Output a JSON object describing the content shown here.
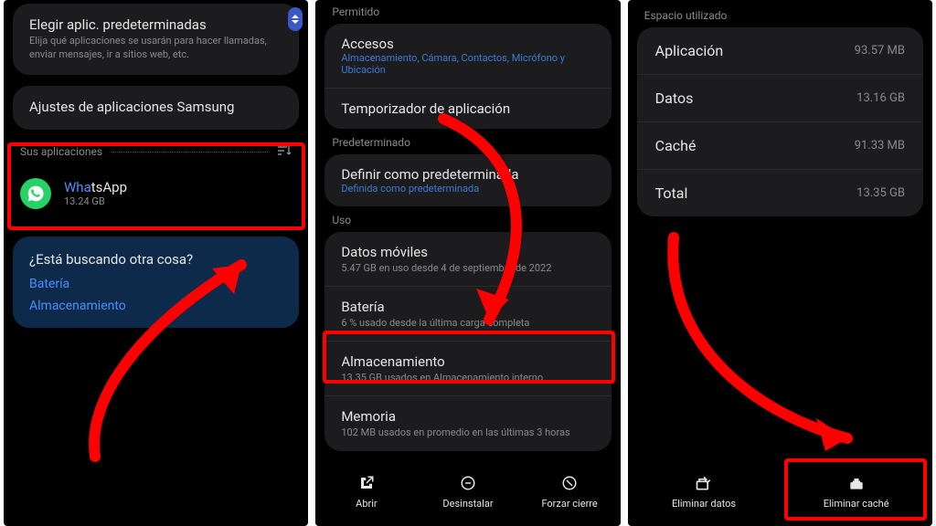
{
  "panel1": {
    "defaultApps": {
      "title": "Elegir aplic. predeterminadas",
      "sub": "Elija qué aplicaciones se usarán para hacer llamadas, enviar mensajes, ir a sitios web, etc."
    },
    "samsungSettings": "Ajustes de aplicaciones Samsung",
    "yourApps": "Sus aplicaciones",
    "app": {
      "namePrefix": "Wha",
      "nameRest": "tsApp",
      "size": "13.24 GB"
    },
    "suggest": {
      "title": "¿Está buscando otra cosa?",
      "battery": "Batería",
      "storage": "Almacenamiento"
    }
  },
  "panel2": {
    "permitted": "Permitido",
    "access": {
      "title": "Accesos",
      "sub": "Almacenamiento, Cámara, Contactos, Micrófono y Ubicación"
    },
    "timer": "Temporizador de aplicación",
    "defaultHeader": "Predeterminado",
    "setDefault": {
      "title": "Definir como predeterminada",
      "sub": "Definida como predeterminada"
    },
    "usageHeader": "Uso",
    "mobileData": {
      "title": "Datos móviles",
      "sub": "5.47 GB en uso desde 4 de septiembre de 2022"
    },
    "battery": {
      "title": "Batería",
      "sub": "6 % usado desde la última carga completa"
    },
    "storage": {
      "title": "Almacenamiento",
      "sub": "13.35 GB usados en Almacenamiento interno"
    },
    "memory": {
      "title": "Memoria",
      "sub": "102 MB usados en promedio en las últimas 3 horas"
    },
    "bottom": {
      "open": "Abrir",
      "uninstall": "Desinstalar",
      "forceStop": "Forzar cierre"
    }
  },
  "panel3": {
    "header": "Espacio utilizado",
    "rows": {
      "app": {
        "label": "Aplicación",
        "value": "93.57 MB"
      },
      "data": {
        "label": "Datos",
        "value": "13.16 GB"
      },
      "cache": {
        "label": "Caché",
        "value": "91.33 MB"
      },
      "total": {
        "label": "Total",
        "value": "13.35 GB"
      }
    },
    "bottom": {
      "clearData": "Eliminar datos",
      "clearCache": "Eliminar caché"
    }
  }
}
